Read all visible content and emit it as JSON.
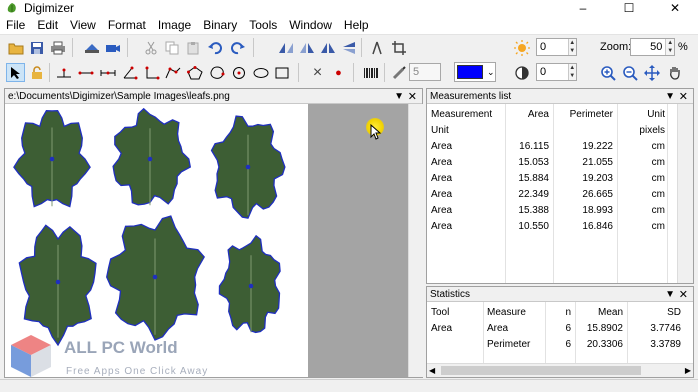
{
  "window": {
    "title": "Digimizer",
    "minimize": "–",
    "maximize": "☐",
    "close": "✕"
  },
  "menu": [
    "File",
    "Edit",
    "View",
    "Format",
    "Image",
    "Binary",
    "Tools",
    "Window",
    "Help"
  ],
  "toolbar": {
    "brightness_value": "0",
    "contrast_value": "0",
    "zoom_label": "Zoom:",
    "zoom_value": "50",
    "zoom_unit": "%",
    "line_width_value": "5",
    "color_swatch": "#0000ff",
    "delete_glyph": "×",
    "point_glyph": "●"
  },
  "image_window": {
    "path": "e:\\Documents\\Digimizer\\Sample Images\\leafs.png",
    "leaf_color": "#3d5e34",
    "outline_color": "#1f2fbf"
  },
  "measurements": {
    "title": "Measurements list",
    "headers": [
      "Measurement",
      "Area",
      "Perimeter",
      "Unit"
    ],
    "subheaders": [
      "Unit",
      "",
      "",
      "pixels"
    ],
    "rows": [
      [
        "Area",
        "16.115",
        "19.222",
        "cm"
      ],
      [
        "Area",
        "15.053",
        "21.055",
        "cm"
      ],
      [
        "Area",
        "15.884",
        "19.203",
        "cm"
      ],
      [
        "Area",
        "22.349",
        "26.665",
        "cm"
      ],
      [
        "Area",
        "15.388",
        "18.993",
        "cm"
      ],
      [
        "Area",
        "10.550",
        "16.846",
        "cm"
      ]
    ]
  },
  "statistics": {
    "title": "Statistics",
    "headers": [
      "Tool",
      "Measure",
      "n",
      "Mean",
      "SD"
    ],
    "rows": [
      [
        "Area",
        "Area",
        "6",
        "15.8902",
        "3.7746"
      ],
      [
        "",
        "Perimeter",
        "6",
        "20.3306",
        "3.3789"
      ]
    ]
  },
  "watermark": {
    "brand": "ALL PC World",
    "tagline": "Free Apps One Click Away"
  }
}
